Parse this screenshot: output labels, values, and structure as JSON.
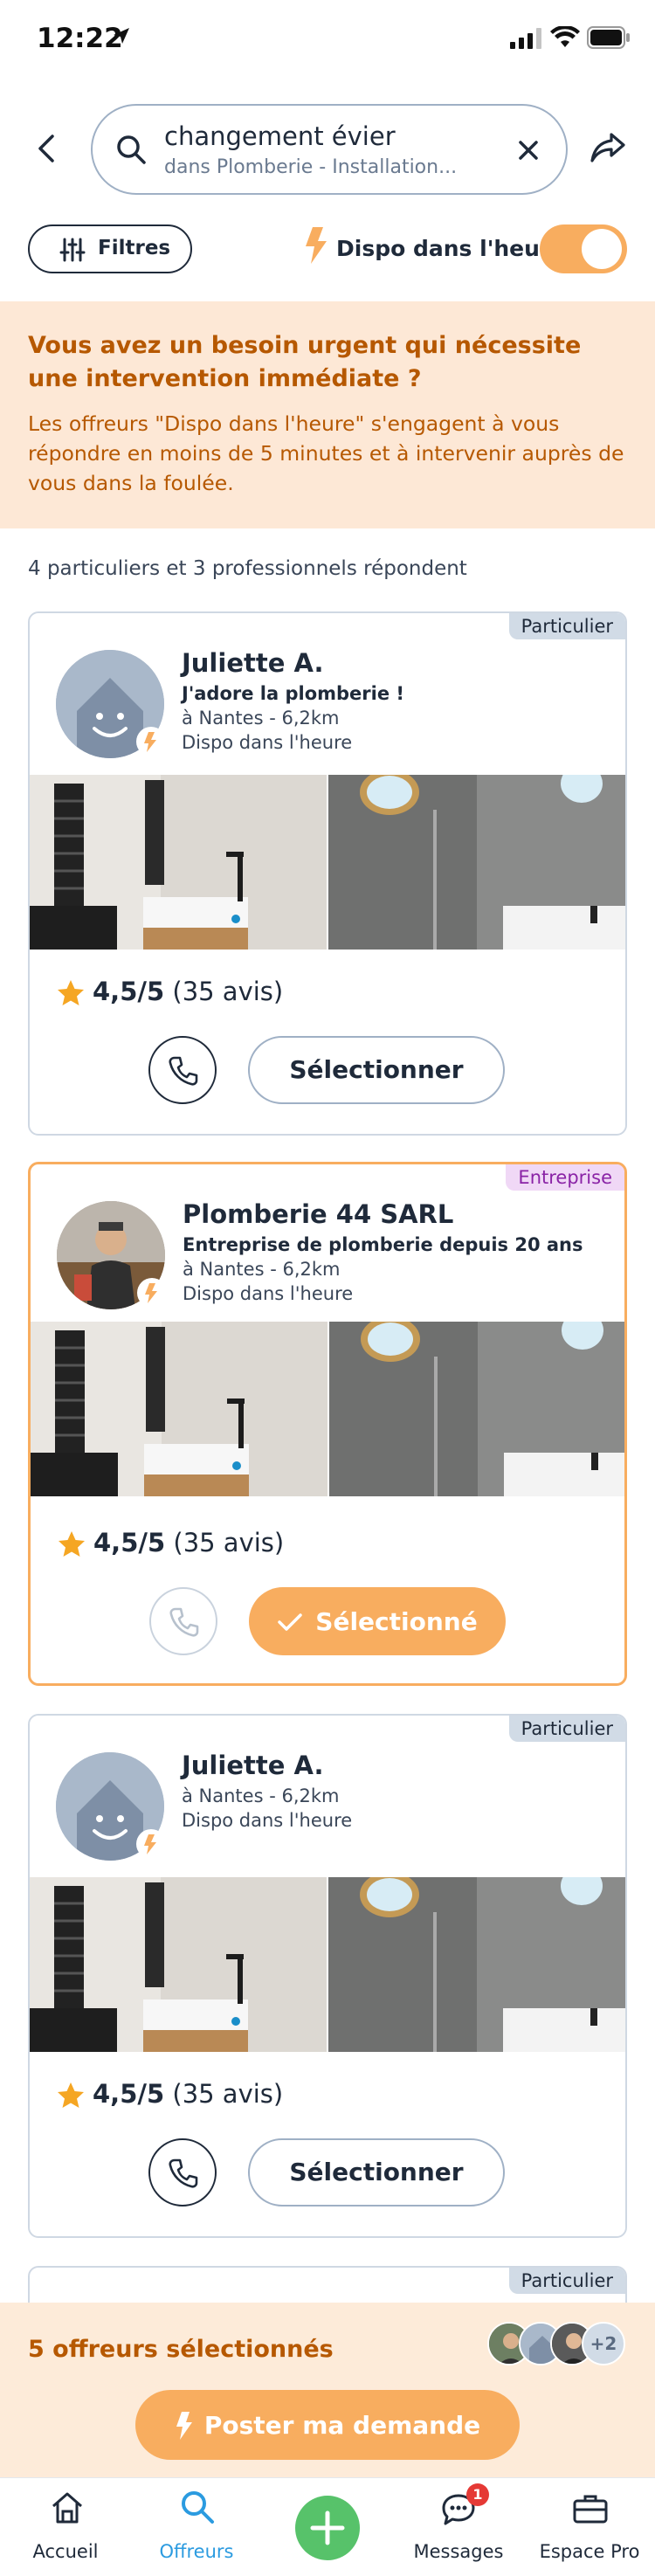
{
  "status_bar": {
    "time": "12:22"
  },
  "search": {
    "query": "changement évier",
    "context": "dans Plomberie - Installation..."
  },
  "filters": {
    "filters_label": "Filtres",
    "dispo_label": "Dispo dans l'heure",
    "dispo_on": true
  },
  "urgent_banner": {
    "title": "Vous avez un besoin urgent qui nécessite une intervention immédiate ?",
    "text": "Les offreurs \"Dispo dans l'heure\" s'engagent à vous répondre en moins de 5 minutes et à intervenir auprès de vous dans la foulée."
  },
  "responders_summary": "4 particuliers et 3 professionnels répondent",
  "cards": [
    {
      "badge": "Particulier",
      "name": "Juliette A.",
      "tagline": "J'adore la plomberie !",
      "location": "à Nantes - 6,2km",
      "availability": "Dispo dans l'heure",
      "rating": "4,5/5",
      "reviews": "(35 avis)",
      "button": "Sélectionner",
      "selected": false
    },
    {
      "badge": "Entreprise",
      "name": "Plomberie 44 SARL",
      "tagline": "Entreprise de plomberie depuis 20 ans",
      "location": "à Nantes - 6,2km",
      "availability": "Dispo dans l'heure",
      "rating": "4,5/5",
      "reviews": "(35 avis)",
      "button": "Sélectionné",
      "selected": true
    },
    {
      "badge": "Particulier",
      "name": "Juliette A.",
      "location": "à Nantes - 6,2km",
      "availability": "Dispo dans l'heure",
      "rating": "4,5/5",
      "reviews": "(35 avis)",
      "button": "Sélectionner",
      "selected": false
    },
    {
      "badge": "Particulier"
    }
  ],
  "selection_bar": {
    "title": "5 offreurs sélectionnés",
    "extra_count": "+2",
    "post_button": "Poster ma demande"
  },
  "tabbar": {
    "items": [
      {
        "label": "Accueil",
        "icon": "home-icon",
        "active": false
      },
      {
        "label": "Offreurs",
        "icon": "search-icon",
        "active": true
      },
      {
        "label": "",
        "icon": "plus-icon",
        "active": false
      },
      {
        "label": "Messages",
        "icon": "chat-icon",
        "active": false,
        "badge": "1"
      },
      {
        "label": "Espace Pro",
        "icon": "briefcase-icon",
        "active": false
      }
    ]
  },
  "colors": {
    "accent_orange": "#f8ad5f",
    "urgent_text": "#b65800",
    "active_tab": "#2b9be0",
    "plus_button": "#57c26a"
  }
}
